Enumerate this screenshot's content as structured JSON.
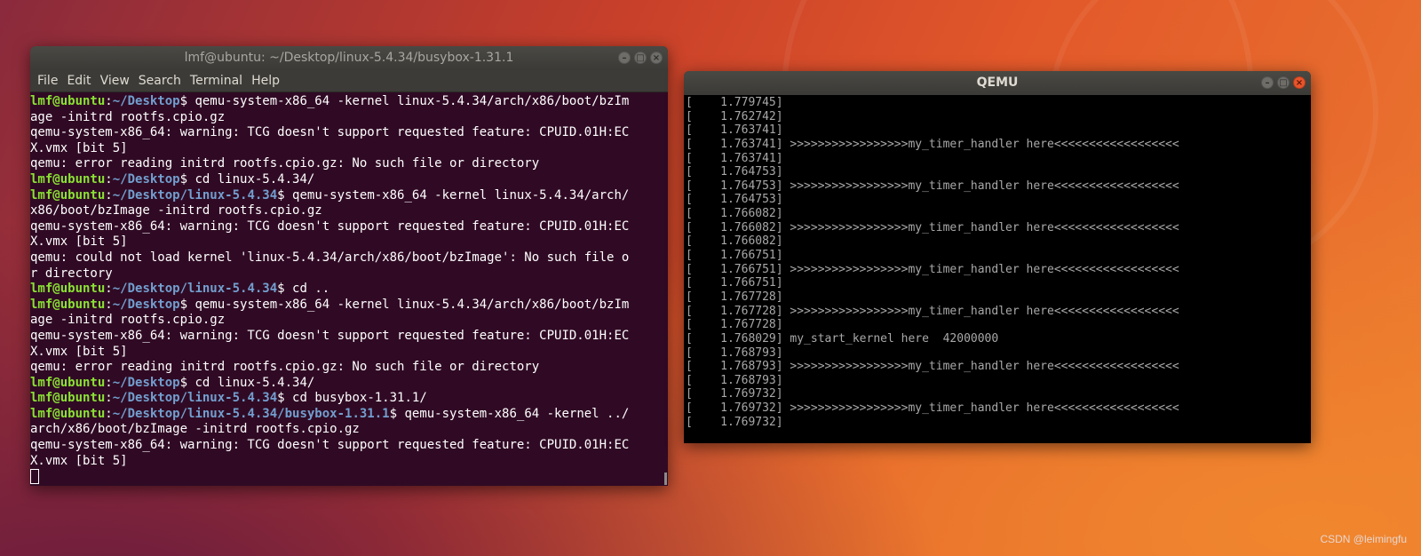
{
  "terminal": {
    "title": "lmf@ubuntu: ~/Desktop/linux-5.4.34/busybox-1.31.1",
    "menu": [
      "File",
      "Edit",
      "View",
      "Search",
      "Terminal",
      "Help"
    ],
    "lines": [
      [
        {
          "c": "u",
          "t": "lmf@ubuntu"
        },
        {
          "c": "",
          "t": ":"
        },
        {
          "c": "p",
          "t": "~/Desktop"
        },
        {
          "c": "",
          "t": "$ qemu-system-x86_64 -kernel linux-5.4.34/arch/x86/boot/bzIm"
        }
      ],
      [
        {
          "c": "",
          "t": "age -initrd rootfs.cpio.gz"
        }
      ],
      [
        {
          "c": "",
          "t": "qemu-system-x86_64: warning: TCG doesn't support requested feature: CPUID.01H:EC"
        }
      ],
      [
        {
          "c": "",
          "t": "X.vmx [bit 5]"
        }
      ],
      [
        {
          "c": "",
          "t": "qemu: error reading initrd rootfs.cpio.gz: No such file or directory"
        }
      ],
      [
        {
          "c": "u",
          "t": "lmf@ubuntu"
        },
        {
          "c": "",
          "t": ":"
        },
        {
          "c": "p",
          "t": "~/Desktop"
        },
        {
          "c": "",
          "t": "$ cd linux-5.4.34/"
        }
      ],
      [
        {
          "c": "u",
          "t": "lmf@ubuntu"
        },
        {
          "c": "",
          "t": ":"
        },
        {
          "c": "p",
          "t": "~/Desktop/linux-5.4.34"
        },
        {
          "c": "",
          "t": "$ qemu-system-x86_64 -kernel linux-5.4.34/arch/"
        }
      ],
      [
        {
          "c": "",
          "t": "x86/boot/bzImage -initrd rootfs.cpio.gz"
        }
      ],
      [
        {
          "c": "",
          "t": "qemu-system-x86_64: warning: TCG doesn't support requested feature: CPUID.01H:EC"
        }
      ],
      [
        {
          "c": "",
          "t": "X.vmx [bit 5]"
        }
      ],
      [
        {
          "c": "",
          "t": "qemu: could not load kernel 'linux-5.4.34/arch/x86/boot/bzImage': No such file o"
        }
      ],
      [
        {
          "c": "",
          "t": "r directory"
        }
      ],
      [
        {
          "c": "u",
          "t": "lmf@ubuntu"
        },
        {
          "c": "",
          "t": ":"
        },
        {
          "c": "p",
          "t": "~/Desktop/linux-5.4.34"
        },
        {
          "c": "",
          "t": "$ cd .."
        }
      ],
      [
        {
          "c": "u",
          "t": "lmf@ubuntu"
        },
        {
          "c": "",
          "t": ":"
        },
        {
          "c": "p",
          "t": "~/Desktop"
        },
        {
          "c": "",
          "t": "$ qemu-system-x86_64 -kernel linux-5.4.34/arch/x86/boot/bzIm"
        }
      ],
      [
        {
          "c": "",
          "t": "age -initrd rootfs.cpio.gz"
        }
      ],
      [
        {
          "c": "",
          "t": "qemu-system-x86_64: warning: TCG doesn't support requested feature: CPUID.01H:EC"
        }
      ],
      [
        {
          "c": "",
          "t": "X.vmx [bit 5]"
        }
      ],
      [
        {
          "c": "",
          "t": "qemu: error reading initrd rootfs.cpio.gz: No such file or directory"
        }
      ],
      [
        {
          "c": "u",
          "t": "lmf@ubuntu"
        },
        {
          "c": "",
          "t": ":"
        },
        {
          "c": "p",
          "t": "~/Desktop"
        },
        {
          "c": "",
          "t": "$ cd linux-5.4.34/"
        }
      ],
      [
        {
          "c": "u",
          "t": "lmf@ubuntu"
        },
        {
          "c": "",
          "t": ":"
        },
        {
          "c": "p",
          "t": "~/Desktop/linux-5.4.34"
        },
        {
          "c": "",
          "t": "$ cd busybox-1.31.1/"
        }
      ],
      [
        {
          "c": "u",
          "t": "lmf@ubuntu"
        },
        {
          "c": "",
          "t": ":"
        },
        {
          "c": "p",
          "t": "~/Desktop/linux-5.4.34/busybox-1.31.1"
        },
        {
          "c": "",
          "t": "$ qemu-system-x86_64 -kernel ../"
        }
      ],
      [
        {
          "c": "",
          "t": "arch/x86/boot/bzImage -initrd rootfs.cpio.gz"
        }
      ],
      [
        {
          "c": "",
          "t": "qemu-system-x86_64: warning: TCG doesn't support requested feature: CPUID.01H:EC"
        }
      ],
      [
        {
          "c": "",
          "t": "X.vmx [bit 5]"
        }
      ]
    ]
  },
  "qemu": {
    "title": "QEMU",
    "lines": [
      "[    1.779745]",
      "[    1.762742]",
      "[    1.763741]",
      "[    1.763741] >>>>>>>>>>>>>>>>>my_timer_handler here<<<<<<<<<<<<<<<<<<",
      "[    1.763741]",
      "[    1.764753]",
      "[    1.764753] >>>>>>>>>>>>>>>>>my_timer_handler here<<<<<<<<<<<<<<<<<<",
      "[    1.764753]",
      "[    1.766082]",
      "[    1.766082] >>>>>>>>>>>>>>>>>my_timer_handler here<<<<<<<<<<<<<<<<<<",
      "[    1.766082]",
      "[    1.766751]",
      "[    1.766751] >>>>>>>>>>>>>>>>>my_timer_handler here<<<<<<<<<<<<<<<<<<",
      "[    1.766751]",
      "[    1.767728]",
      "[    1.767728] >>>>>>>>>>>>>>>>>my_timer_handler here<<<<<<<<<<<<<<<<<<",
      "[    1.767728]",
      "[    1.768029] my_start_kernel here  42000000",
      "[    1.768793]",
      "[    1.768793] >>>>>>>>>>>>>>>>>my_timer_handler here<<<<<<<<<<<<<<<<<<",
      "[    1.768793]",
      "[    1.769732]",
      "[    1.769732] >>>>>>>>>>>>>>>>>my_timer_handler here<<<<<<<<<<<<<<<<<<",
      "[    1.769732]"
    ]
  },
  "watermark": "CSDN @leimingfu",
  "colors": {
    "terminal_bg": "#300a24",
    "user_host": "#8ae234",
    "path": "#729fcf",
    "qemu_bg": "#000000",
    "close_button": "#e9542b"
  }
}
